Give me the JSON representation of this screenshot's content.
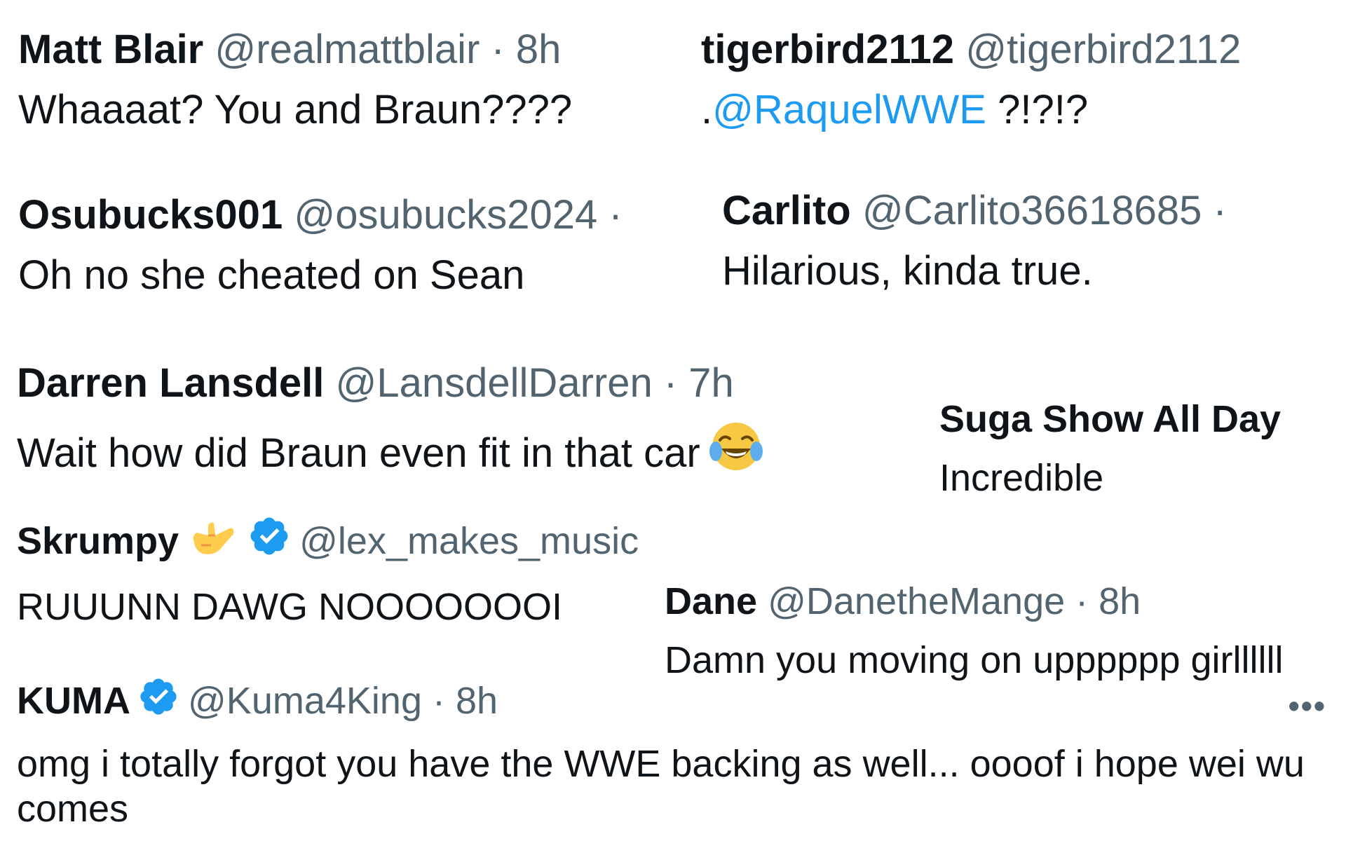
{
  "tweets": [
    {
      "name": "Matt Blair",
      "handle": "@realmattblair · 8h",
      "text": "Whaaaat? You and Braun????"
    },
    {
      "name": "tigerbird2112",
      "handle": "@tigerbird2112",
      "text_prefix": ".",
      "mention": "@RaquelWWE",
      "text_suffix": " ?!?!?"
    },
    {
      "name": "Osubucks001",
      "handle": "@osubucks2024 ·",
      "text": "Oh no she cheated on Sean"
    },
    {
      "name": "Carlito",
      "handle": "@Carlito36618685 ·",
      "text": "Hilarious, kinda true."
    },
    {
      "name": "Darren Lansdell",
      "handle": "@LansdellDarren · 7h",
      "text": "Wait how did Braun even fit in that car",
      "emoji": "face-with-tears-of-joy-icon"
    },
    {
      "name": "Suga Show All Day",
      "text": "Incredible"
    },
    {
      "name": "Skrumpy",
      "name_emoji": "call-me-hand-icon",
      "verified": true,
      "handle": "@lex_makes_music",
      "text": "RUUUNN DAWG NOOOOOOOI"
    },
    {
      "name": "Dane",
      "handle": "@DanetheMange · 8h",
      "text": "Damn you moving on upppppp girllllll"
    },
    {
      "name": "KUMA",
      "verified": true,
      "handle": "@Kuma4King · 8h",
      "text": "omg i totally forgot you have the WWE backing as well... oooof i hope wei wu comes"
    }
  ],
  "more_label": "•••",
  "colors": {
    "text": "#0f1419",
    "handle": "#536471",
    "mention": "#1d9bf0",
    "verified": "#1d9bf0"
  }
}
